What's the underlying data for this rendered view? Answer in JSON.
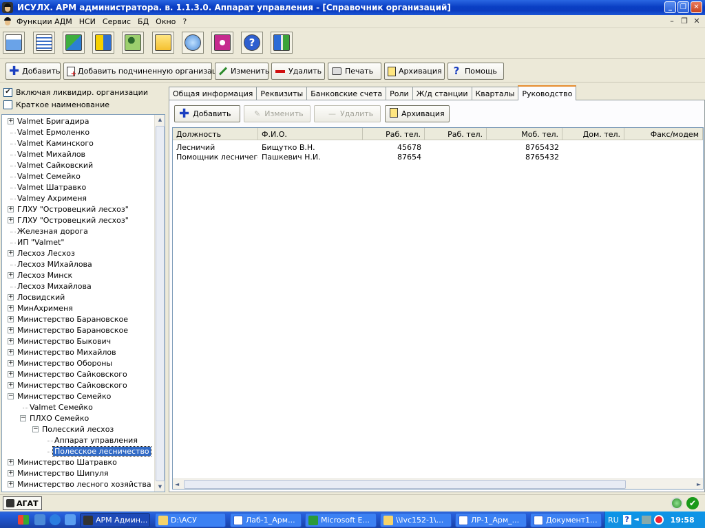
{
  "window": {
    "title": "ИСУЛХ. АРМ администратора. в. 1.1.3.0. Аппарат управления - [Справочник организаций]"
  },
  "menu": [
    "Функции АДМ",
    "НСИ",
    "Сервис",
    "БД",
    "Окно",
    "?"
  ],
  "icon_toolbar": [
    "notepad-icon",
    "list-icon",
    "map-icon",
    "transfer-icon",
    "users-icon",
    "edit-document-icon",
    "magnifier-icon",
    "camera-icon",
    "help-icon",
    "exit-icon"
  ],
  "action_toolbar": {
    "add": "Добавить",
    "add_sub": "Добавить подчиненную организацию",
    "edit": "Изменить",
    "delete": "Удалить",
    "print": "Печать",
    "archive": "Архивация",
    "help": "Помощь"
  },
  "filters": {
    "include_liquidated": {
      "label": "Включая ликвидир. организации",
      "checked": true
    },
    "short_name": {
      "label": "Краткое наименование",
      "checked": false
    }
  },
  "tree": [
    {
      "label": "Valmet Бригадира",
      "level": 0,
      "expander": "+"
    },
    {
      "label": "Valmet Ермоленко",
      "level": 0,
      "expander": ""
    },
    {
      "label": "Valmet Каминского",
      "level": 0,
      "expander": ""
    },
    {
      "label": "Valmet Михайлов",
      "level": 0,
      "expander": ""
    },
    {
      "label": "Valmet Сайковский",
      "level": 0,
      "expander": ""
    },
    {
      "label": "Valmet Семейко",
      "level": 0,
      "expander": ""
    },
    {
      "label": "Valmet Шатравко",
      "level": 0,
      "expander": ""
    },
    {
      "label": "Valmey Ахрименя",
      "level": 0,
      "expander": ""
    },
    {
      "label": "ГЛХУ \"Островецкий лесхоз\"",
      "level": 0,
      "expander": "+"
    },
    {
      "label": "ГЛХУ \"Островецкий лесхоз\"",
      "level": 0,
      "expander": "+"
    },
    {
      "label": "Железная дорога",
      "level": 0,
      "expander": ""
    },
    {
      "label": "ИП \"Valmet\"",
      "level": 0,
      "expander": ""
    },
    {
      "label": "Лесхоз Лесхоз",
      "level": 0,
      "expander": "+"
    },
    {
      "label": "Лесхоз МИхайлова",
      "level": 0,
      "expander": ""
    },
    {
      "label": "Лесхоз Минск",
      "level": 0,
      "expander": "+"
    },
    {
      "label": "Лесхоз Михайлова",
      "level": 0,
      "expander": ""
    },
    {
      "label": "Лосвидский",
      "level": 0,
      "expander": "+"
    },
    {
      "label": "МинАхрименя",
      "level": 0,
      "expander": "+"
    },
    {
      "label": "Министерство Барановское",
      "level": 0,
      "expander": "+"
    },
    {
      "label": "Министерство Барановское",
      "level": 0,
      "expander": "+"
    },
    {
      "label": "Министерство Быкович",
      "level": 0,
      "expander": "+"
    },
    {
      "label": "Министерство Михайлов",
      "level": 0,
      "expander": "+"
    },
    {
      "label": "Министерство Обороны",
      "level": 0,
      "expander": "+"
    },
    {
      "label": "Министерство Сайковского",
      "level": 0,
      "expander": "+"
    },
    {
      "label": "Министерство Сайковского",
      "level": 0,
      "expander": "+"
    },
    {
      "label": "Министерство Семейко",
      "level": 0,
      "expander": "−"
    },
    {
      "label": "Valmet Семейко",
      "level": 1,
      "expander": ""
    },
    {
      "label": "ПЛХО Семейко",
      "level": 1,
      "expander": "−"
    },
    {
      "label": "Полесский лесхоз",
      "level": 2,
      "expander": "−"
    },
    {
      "label": "Аппарат управления",
      "level": 3,
      "expander": ""
    },
    {
      "label": "Полесское лесничество",
      "level": 3,
      "expander": "",
      "selected": true
    },
    {
      "label": "Министерство Шатравко",
      "level": 0,
      "expander": "+"
    },
    {
      "label": "Министерство Шипуля",
      "level": 0,
      "expander": "+"
    },
    {
      "label": "Министерство лесного хозяйства",
      "level": 0,
      "expander": "+"
    }
  ],
  "tabs": [
    "Общая информация",
    "Реквизиты",
    "Банковские счета",
    "Роли",
    "Ж/д станции",
    "Кварталы",
    "Руководство"
  ],
  "active_tab": "Руководство",
  "tab_toolbar": {
    "add": "Добавить",
    "edit": "Изменить",
    "delete": "Удалить",
    "archive": "Архивация"
  },
  "table": {
    "columns": [
      "Должность",
      "Ф.И.О.",
      "Раб. тел.",
      "Раб. тел.",
      "Моб. тел.",
      "Дом. тел.",
      "Факс/модем"
    ],
    "rows": [
      [
        "Лесничий",
        "Бищутко В.Н.",
        "45678",
        "",
        "8765432",
        "",
        ""
      ],
      [
        "Помощник лесничего",
        "Пашкевич Н.И.",
        "87654",
        "",
        "8765432",
        "",
        ""
      ]
    ]
  },
  "status": {
    "logo_text": "АГАТ"
  },
  "taskbar": {
    "tasks": [
      "АРМ Админ...",
      "D:\\АСУ",
      "Лаб-1_Арм...",
      "Microsoft E...",
      "\\\\lvc152-1\\...",
      "ЛР-1_Арм_...",
      "Документ1..."
    ],
    "lang": "RU",
    "clock": "19:58"
  }
}
